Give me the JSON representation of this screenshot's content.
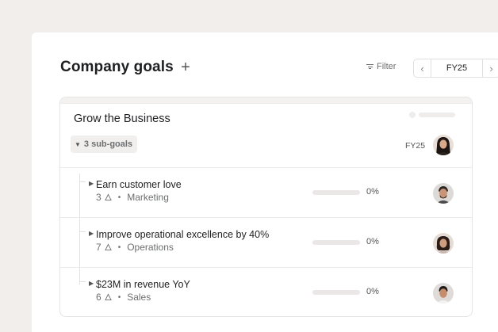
{
  "header": {
    "title": "Company goals",
    "add_label": "+",
    "filter_label": "Filter",
    "period_value": "FY25",
    "prev_label": "‹",
    "next_label": "›"
  },
  "goal": {
    "title": "Grow the Business",
    "subgoals_label": "3 sub-goals",
    "period": "FY25",
    "owner_avatar": "avatar-woman-dark-hair"
  },
  "subgoals": [
    {
      "name": "Earn customer love",
      "count": "3",
      "team": "Marketing",
      "progress_label": "0%",
      "progress": 0,
      "avatar": "avatar-man-beard"
    },
    {
      "name": "Improve operational excellence by 40%",
      "count": "7",
      "team": "Operations",
      "progress_label": "0%",
      "progress": 0,
      "avatar": "avatar-woman-curly"
    },
    {
      "name": "$23M in revenue YoY",
      "count": "6",
      "team": "Sales",
      "progress_label": "0%",
      "progress": 0,
      "avatar": "avatar-man-short-hair"
    }
  ],
  "colors": {
    "background": "#f1eeec",
    "panel": "#ffffff",
    "progress_track": "#eae7e6",
    "muted_text": "#6d6e6f"
  }
}
